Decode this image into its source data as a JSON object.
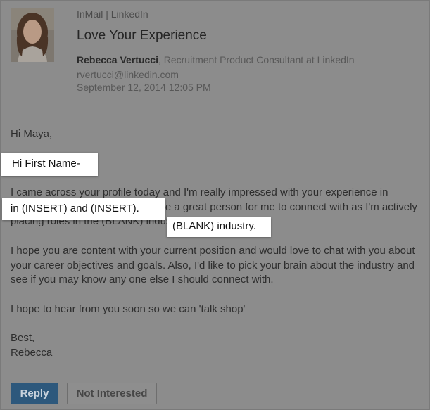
{
  "header": {
    "source": "InMail | LinkedIn",
    "subject": "Love Your Experience",
    "sender_name": "Rebecca Vertucci",
    "sender_title": ", Recruitment Product Consultant at LinkedIn",
    "sender_email": "rvertucci@linkedin.com",
    "sent_date": "September 12, 2014 12:05 PM"
  },
  "message": {
    "greeting": "Hi Maya,",
    "paragraph1": "I came across your profile today and I'm really impressed with your experience in (INSERT) and (INSERT). You'd be a great person for me to connect with as I'm actively placing roles in the (BLANK) industry.",
    "paragraph2": "I hope you are content with your current position and would love to chat with you about your career objectives and goals. Also, I'd like to pick your brain about the industry and see if you may know any one else I should connect with.",
    "paragraph3": "I hope to hear from you soon so we can 'talk shop'",
    "closing": "Best,",
    "signature": "Rebecca"
  },
  "callouts": {
    "first_name": "Hi First Name-",
    "insert": "in (INSERT) and (INSERT).",
    "blank": "(BLANK) industry."
  },
  "actions": {
    "reply_label": "Reply",
    "not_interested_label": "Not Interested"
  },
  "colors": {
    "overlay": "#8c8c8c",
    "reply_button": "#2d587c"
  }
}
